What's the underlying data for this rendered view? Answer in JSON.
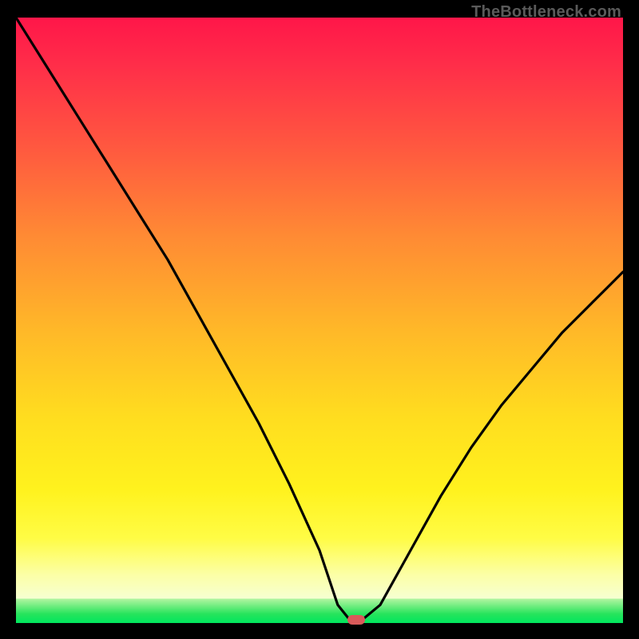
{
  "watermark": "TheBottleneck.com",
  "colors": {
    "frame_bg": "#000000",
    "watermark_text": "#5a5a5a",
    "curve_stroke": "#000000",
    "marker_fill": "#d95a5a",
    "gradient_top": "#ff1649",
    "gradient_mid": "#ffdd1f",
    "gradient_low": "#fcffa6",
    "green_band": "#00e65e"
  },
  "chart_data": {
    "type": "line",
    "title": "",
    "xlabel": "",
    "ylabel": "",
    "xlim": [
      0,
      100
    ],
    "ylim": [
      0,
      100
    ],
    "x": [
      0,
      5,
      10,
      15,
      20,
      25,
      30,
      35,
      40,
      45,
      50,
      53,
      55,
      57,
      60,
      65,
      70,
      75,
      80,
      85,
      90,
      95,
      100
    ],
    "y": [
      100,
      92,
      84,
      76,
      68,
      60,
      51,
      42,
      33,
      23,
      12,
      3,
      0.5,
      0.5,
      3,
      12,
      21,
      29,
      36,
      42,
      48,
      53,
      58
    ],
    "note": "V-shaped bottleneck curve; minimum (optimal balance) occurs near x≈56 where it touches the green band at the bottom.",
    "marker": {
      "x": 56,
      "y": 0.5
    },
    "grid": false,
    "legend": false
  }
}
